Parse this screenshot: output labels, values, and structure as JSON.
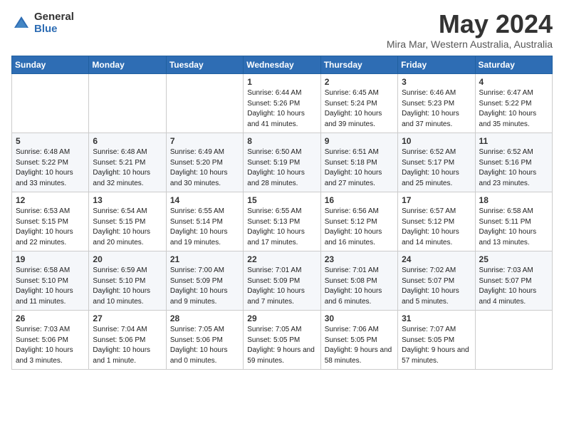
{
  "logo": {
    "general": "General",
    "blue": "Blue"
  },
  "title": "May 2024",
  "location": "Mira Mar, Western Australia, Australia",
  "weekdays": [
    "Sunday",
    "Monday",
    "Tuesday",
    "Wednesday",
    "Thursday",
    "Friday",
    "Saturday"
  ],
  "weeks": [
    [
      {
        "day": "",
        "info": ""
      },
      {
        "day": "",
        "info": ""
      },
      {
        "day": "",
        "info": ""
      },
      {
        "day": "1",
        "info": "Sunrise: 6:44 AM\nSunset: 5:26 PM\nDaylight: 10 hours\nand 41 minutes."
      },
      {
        "day": "2",
        "info": "Sunrise: 6:45 AM\nSunset: 5:24 PM\nDaylight: 10 hours\nand 39 minutes."
      },
      {
        "day": "3",
        "info": "Sunrise: 6:46 AM\nSunset: 5:23 PM\nDaylight: 10 hours\nand 37 minutes."
      },
      {
        "day": "4",
        "info": "Sunrise: 6:47 AM\nSunset: 5:22 PM\nDaylight: 10 hours\nand 35 minutes."
      }
    ],
    [
      {
        "day": "5",
        "info": "Sunrise: 6:48 AM\nSunset: 5:22 PM\nDaylight: 10 hours\nand 33 minutes."
      },
      {
        "day": "6",
        "info": "Sunrise: 6:48 AM\nSunset: 5:21 PM\nDaylight: 10 hours\nand 32 minutes."
      },
      {
        "day": "7",
        "info": "Sunrise: 6:49 AM\nSunset: 5:20 PM\nDaylight: 10 hours\nand 30 minutes."
      },
      {
        "day": "8",
        "info": "Sunrise: 6:50 AM\nSunset: 5:19 PM\nDaylight: 10 hours\nand 28 minutes."
      },
      {
        "day": "9",
        "info": "Sunrise: 6:51 AM\nSunset: 5:18 PM\nDaylight: 10 hours\nand 27 minutes."
      },
      {
        "day": "10",
        "info": "Sunrise: 6:52 AM\nSunset: 5:17 PM\nDaylight: 10 hours\nand 25 minutes."
      },
      {
        "day": "11",
        "info": "Sunrise: 6:52 AM\nSunset: 5:16 PM\nDaylight: 10 hours\nand 23 minutes."
      }
    ],
    [
      {
        "day": "12",
        "info": "Sunrise: 6:53 AM\nSunset: 5:15 PM\nDaylight: 10 hours\nand 22 minutes."
      },
      {
        "day": "13",
        "info": "Sunrise: 6:54 AM\nSunset: 5:15 PM\nDaylight: 10 hours\nand 20 minutes."
      },
      {
        "day": "14",
        "info": "Sunrise: 6:55 AM\nSunset: 5:14 PM\nDaylight: 10 hours\nand 19 minutes."
      },
      {
        "day": "15",
        "info": "Sunrise: 6:55 AM\nSunset: 5:13 PM\nDaylight: 10 hours\nand 17 minutes."
      },
      {
        "day": "16",
        "info": "Sunrise: 6:56 AM\nSunset: 5:12 PM\nDaylight: 10 hours\nand 16 minutes."
      },
      {
        "day": "17",
        "info": "Sunrise: 6:57 AM\nSunset: 5:12 PM\nDaylight: 10 hours\nand 14 minutes."
      },
      {
        "day": "18",
        "info": "Sunrise: 6:58 AM\nSunset: 5:11 PM\nDaylight: 10 hours\nand 13 minutes."
      }
    ],
    [
      {
        "day": "19",
        "info": "Sunrise: 6:58 AM\nSunset: 5:10 PM\nDaylight: 10 hours\nand 11 minutes."
      },
      {
        "day": "20",
        "info": "Sunrise: 6:59 AM\nSunset: 5:10 PM\nDaylight: 10 hours\nand 10 minutes."
      },
      {
        "day": "21",
        "info": "Sunrise: 7:00 AM\nSunset: 5:09 PM\nDaylight: 10 hours\nand 9 minutes."
      },
      {
        "day": "22",
        "info": "Sunrise: 7:01 AM\nSunset: 5:09 PM\nDaylight: 10 hours\nand 7 minutes."
      },
      {
        "day": "23",
        "info": "Sunrise: 7:01 AM\nSunset: 5:08 PM\nDaylight: 10 hours\nand 6 minutes."
      },
      {
        "day": "24",
        "info": "Sunrise: 7:02 AM\nSunset: 5:07 PM\nDaylight: 10 hours\nand 5 minutes."
      },
      {
        "day": "25",
        "info": "Sunrise: 7:03 AM\nSunset: 5:07 PM\nDaylight: 10 hours\nand 4 minutes."
      }
    ],
    [
      {
        "day": "26",
        "info": "Sunrise: 7:03 AM\nSunset: 5:06 PM\nDaylight: 10 hours\nand 3 minutes."
      },
      {
        "day": "27",
        "info": "Sunrise: 7:04 AM\nSunset: 5:06 PM\nDaylight: 10 hours\nand 1 minute."
      },
      {
        "day": "28",
        "info": "Sunrise: 7:05 AM\nSunset: 5:06 PM\nDaylight: 10 hours\nand 0 minutes."
      },
      {
        "day": "29",
        "info": "Sunrise: 7:05 AM\nSunset: 5:05 PM\nDaylight: 9 hours\nand 59 minutes."
      },
      {
        "day": "30",
        "info": "Sunrise: 7:06 AM\nSunset: 5:05 PM\nDaylight: 9 hours\nand 58 minutes."
      },
      {
        "day": "31",
        "info": "Sunrise: 7:07 AM\nSunset: 5:05 PM\nDaylight: 9 hours\nand 57 minutes."
      },
      {
        "day": "",
        "info": ""
      }
    ]
  ]
}
